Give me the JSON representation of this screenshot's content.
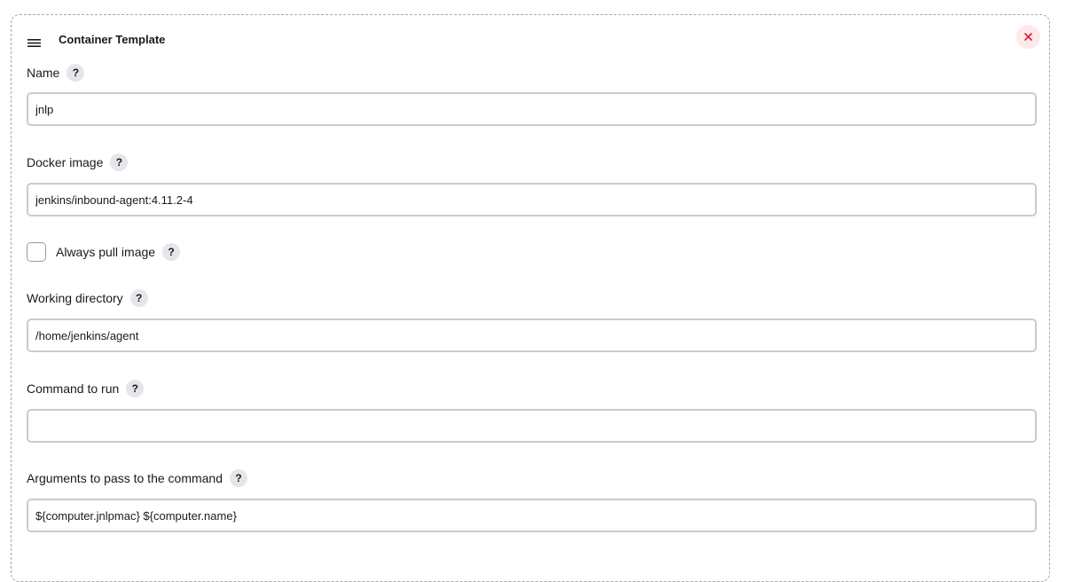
{
  "section": {
    "title": "Container Template",
    "drag_icon": "hamburger-menu-icon",
    "close_icon": "close-x-icon",
    "close_color": "#e01e35",
    "close_bg": "#fde8ea"
  },
  "help_glyph": "?",
  "fields": {
    "name": {
      "label": "Name",
      "value": "jnlp"
    },
    "docker_image": {
      "label": "Docker image",
      "value": "jenkins/inbound-agent:4.11.2-4"
    },
    "always_pull": {
      "label": "Always pull image",
      "checked": false
    },
    "working_directory": {
      "label": "Working directory",
      "value": "/home/jenkins/agent"
    },
    "command": {
      "label": "Command to run",
      "value": ""
    },
    "arguments": {
      "label": "Arguments to pass to the command",
      "value": "${computer.jnlpmac} ${computer.name}"
    }
  }
}
